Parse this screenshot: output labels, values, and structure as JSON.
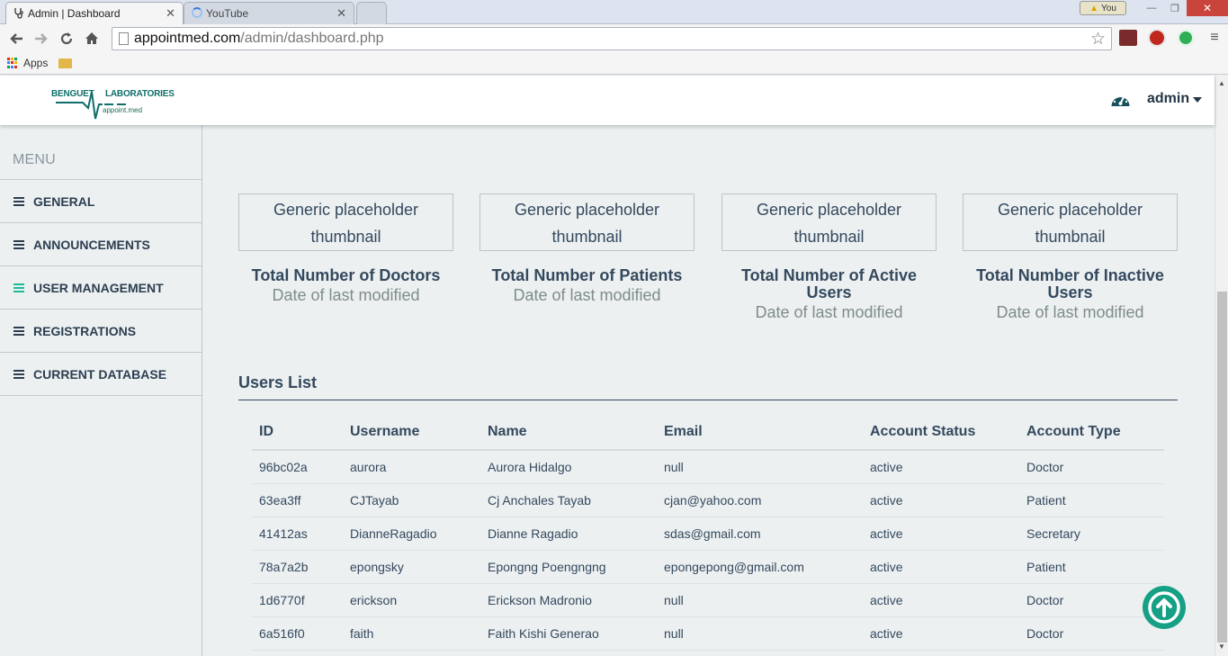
{
  "browser": {
    "tabs": [
      {
        "title": "Admin | Dashboard",
        "active": true
      },
      {
        "title": "YouTube",
        "active": false
      }
    ],
    "profile_label": "You",
    "url_host": "appointmed.com",
    "url_path": "/admin/dashboard.php",
    "bookmarks_label": "Apps"
  },
  "header": {
    "logo_left": "BENGUET",
    "logo_right": "LABORATORIES",
    "logo_sub": "appoint.med",
    "user_label": "admin"
  },
  "sidebar": {
    "title": "MENU",
    "items": [
      {
        "label": "GENERAL"
      },
      {
        "label": "ANNOUNCEMENTS"
      },
      {
        "label": "USER MANAGEMENT"
      },
      {
        "label": "REGISTRATIONS"
      },
      {
        "label": "CURRENT DATABASE"
      }
    ]
  },
  "stats": [
    {
      "thumb_line1": "Generic placeholder",
      "thumb_line2": "thumbnail",
      "title": "Total Number of Doctors",
      "subtitle": "Date of last modified"
    },
    {
      "thumb_line1": "Generic placeholder",
      "thumb_line2": "thumbnail",
      "title": "Total Number of Patients",
      "subtitle": "Date of last modified"
    },
    {
      "thumb_line1": "Generic placeholder",
      "thumb_line2": "thumbnail",
      "title": "Total Number of Active Users",
      "subtitle": "Date of last modified"
    },
    {
      "thumb_line1": "Generic placeholder",
      "thumb_line2": "thumbnail",
      "title": "Total Number of Inactive Users",
      "subtitle": "Date of last modified"
    }
  ],
  "users": {
    "title": "Users List",
    "columns": [
      "ID",
      "Username",
      "Name",
      "Email",
      "Account Status",
      "Account Type"
    ],
    "rows": [
      [
        "96bc02a",
        "aurora",
        "Aurora Hidalgo",
        "null",
        "active",
        "Doctor"
      ],
      [
        "63ea3ff",
        "CJTayab",
        "Cj Anchales Tayab",
        "cjan@yahoo.com",
        "active",
        "Patient"
      ],
      [
        "41412as",
        "DianneRagadio",
        "Dianne Ragadio",
        "sdas@gmail.com",
        "active",
        "Secretary"
      ],
      [
        "78a7a2b",
        "epongsky",
        "Epongng Poengngng",
        "epongepong@gmail.com",
        "active",
        "Patient"
      ],
      [
        "1d6770f",
        "erickson",
        "Erickson Madronio",
        "null",
        "active",
        "Doctor"
      ],
      [
        "6a516f0",
        "faith",
        "Faith Kishi Generao",
        "null",
        "active",
        "Doctor"
      ]
    ]
  },
  "colors": {
    "accent": "#16a085",
    "text_dark": "#34495e",
    "sidebar_bg": "#ecf0f1"
  }
}
